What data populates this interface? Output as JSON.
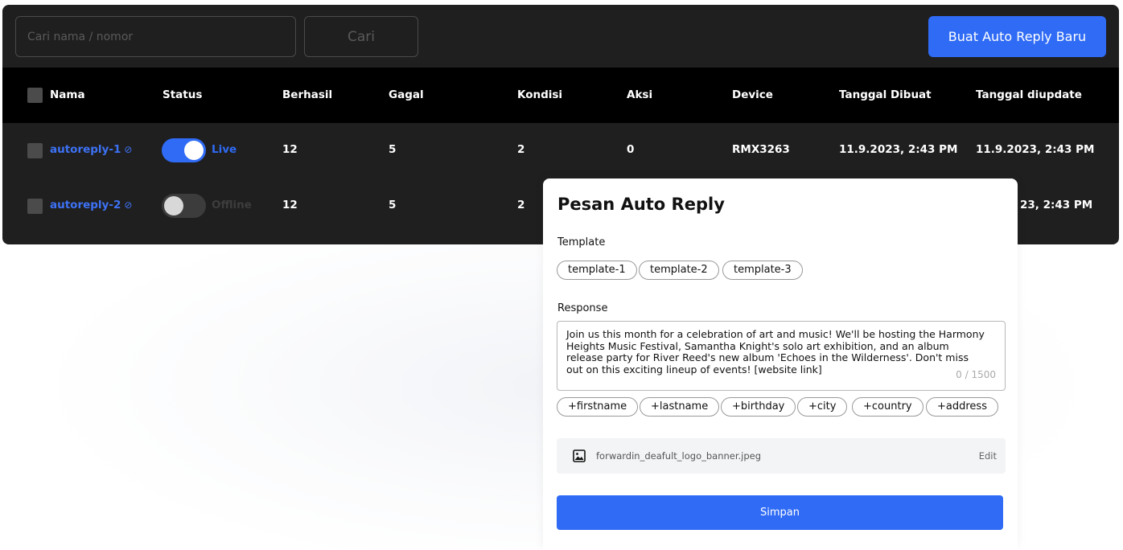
{
  "search": {
    "placeholder": "Cari nama / nomor",
    "button_label": "Cari"
  },
  "new_button_label": "Buat Auto Reply Baru",
  "table": {
    "headers": [
      "Nama",
      "Status",
      "Berhasil",
      "Gagal",
      "Kondisi",
      "Aksi",
      "Device",
      "Tanggal Dibuat",
      "Tanggal diupdate"
    ],
    "rows": [
      {
        "name": "autoreply-1",
        "status": "Live",
        "berhasil": "12",
        "gagal": "5",
        "kondisi": "2",
        "aksi": "0",
        "device": "RMX3263",
        "dibuat": "11.9.2023, 2:43 PM",
        "diupdate": "11.9.2023, 2:43 PM"
      },
      {
        "name": "autoreply-2",
        "status": "Offline",
        "berhasil": "12",
        "gagal": "5",
        "kondisi": "2",
        "diupdate_visible": "23, 2:43 PM"
      }
    ],
    "link_icon": "external-link-icon"
  },
  "modal": {
    "title": "Pesan Auto Reply",
    "template_label": "Template",
    "templates": [
      "template-1",
      "template-2",
      "template-3"
    ],
    "response_label": "Response",
    "response_text": "Join us this month for a celebration of art and music! We'll be hosting the Harmony Heights Music Festival, Samantha Knight's solo art exhibition, and an album release party for River Reed's new album 'Echoes in the Wilderness'. Don't miss out on this exciting lineup of events! [website link]",
    "counter": "0 / 1500",
    "variables": [
      "+firstname",
      "+lastname",
      "+birthday",
      "+city",
      "+country",
      "+address"
    ],
    "file_icon": "image-icon",
    "file_name": "forwardin_deafult_logo_banner.jpeg",
    "edit_label": "Edit",
    "save_label": "Simpan"
  },
  "colors": {
    "accent": "#2f6bf5",
    "app_bg": "#1f1f1f",
    "header_bg": "#000000"
  }
}
